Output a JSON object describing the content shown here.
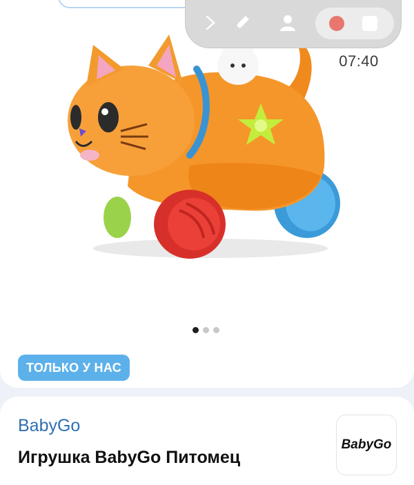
{
  "recording_toolbar": {
    "icons": [
      "chevron-right-icon",
      "pen-icon",
      "user-icon",
      "record-icon",
      "stop-icon"
    ],
    "elapsed_time": "07:40",
    "colors": {
      "bar": "#d9d9d9",
      "record": "#e9776f"
    }
  },
  "gallery": {
    "image_alt": "product-photo-cat-toy",
    "page_count": 3,
    "active_page": 1
  },
  "badge": {
    "label": "ТОЛЬКО У НАС",
    "color": "#5db1ea"
  },
  "product": {
    "brand": "BabyGo",
    "title": "Игрушка BabyGo Питомец",
    "brand_logo_text": "BabyGo"
  }
}
